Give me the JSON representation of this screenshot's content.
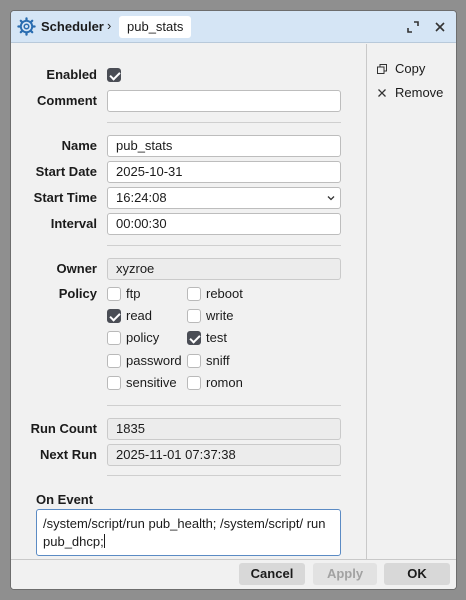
{
  "titlebar": {
    "app": "Scheduler",
    "separator": "›",
    "item": "pub_stats"
  },
  "side_panel": {
    "copy": "Copy",
    "remove": "Remove"
  },
  "form": {
    "enabled_label": "Enabled",
    "enabled": true,
    "comment_label": "Comment",
    "comment_value": "",
    "name_label": "Name",
    "name_value": "pub_stats",
    "start_date_label": "Start Date",
    "start_date_value": "2025-10-31",
    "start_time_label": "Start Time",
    "start_time_value": "16:24:08",
    "interval_label": "Interval",
    "interval_value": "00:00:30",
    "owner_label": "Owner",
    "owner_value": "xyzroe",
    "policy_label": "Policy",
    "policies": [
      {
        "label": "ftp",
        "checked": false
      },
      {
        "label": "reboot",
        "checked": false
      },
      {
        "label": "read",
        "checked": true
      },
      {
        "label": "write",
        "checked": false
      },
      {
        "label": "policy",
        "checked": false
      },
      {
        "label": "test",
        "checked": true
      },
      {
        "label": "password",
        "checked": false
      },
      {
        "label": "sniff",
        "checked": false
      },
      {
        "label": "sensitive",
        "checked": false
      },
      {
        "label": "romon",
        "checked": false
      }
    ],
    "run_count_label": "Run Count",
    "run_count_value": "1835",
    "next_run_label": "Next Run",
    "next_run_value": "2025-11-01 07:37:38",
    "on_event_label": "On Event",
    "on_event_value": "/system/script/run pub_health; /system/script/ run pub_dhcp;"
  },
  "footer": {
    "cancel": "Cancel",
    "apply": "Apply",
    "ok": "OK"
  },
  "colors": {
    "titlebar": "#d5e5f5",
    "window": "#f1f1f1",
    "accent_border": "#5b8bc4",
    "checkbox_on": "#4a4d55"
  },
  "icons": {
    "app": "gear-icon",
    "expand": "expand-icon",
    "close": "close-icon",
    "copy": "copy-icon",
    "remove": "remove-icon",
    "dropdown": "chevron-down-icon"
  }
}
